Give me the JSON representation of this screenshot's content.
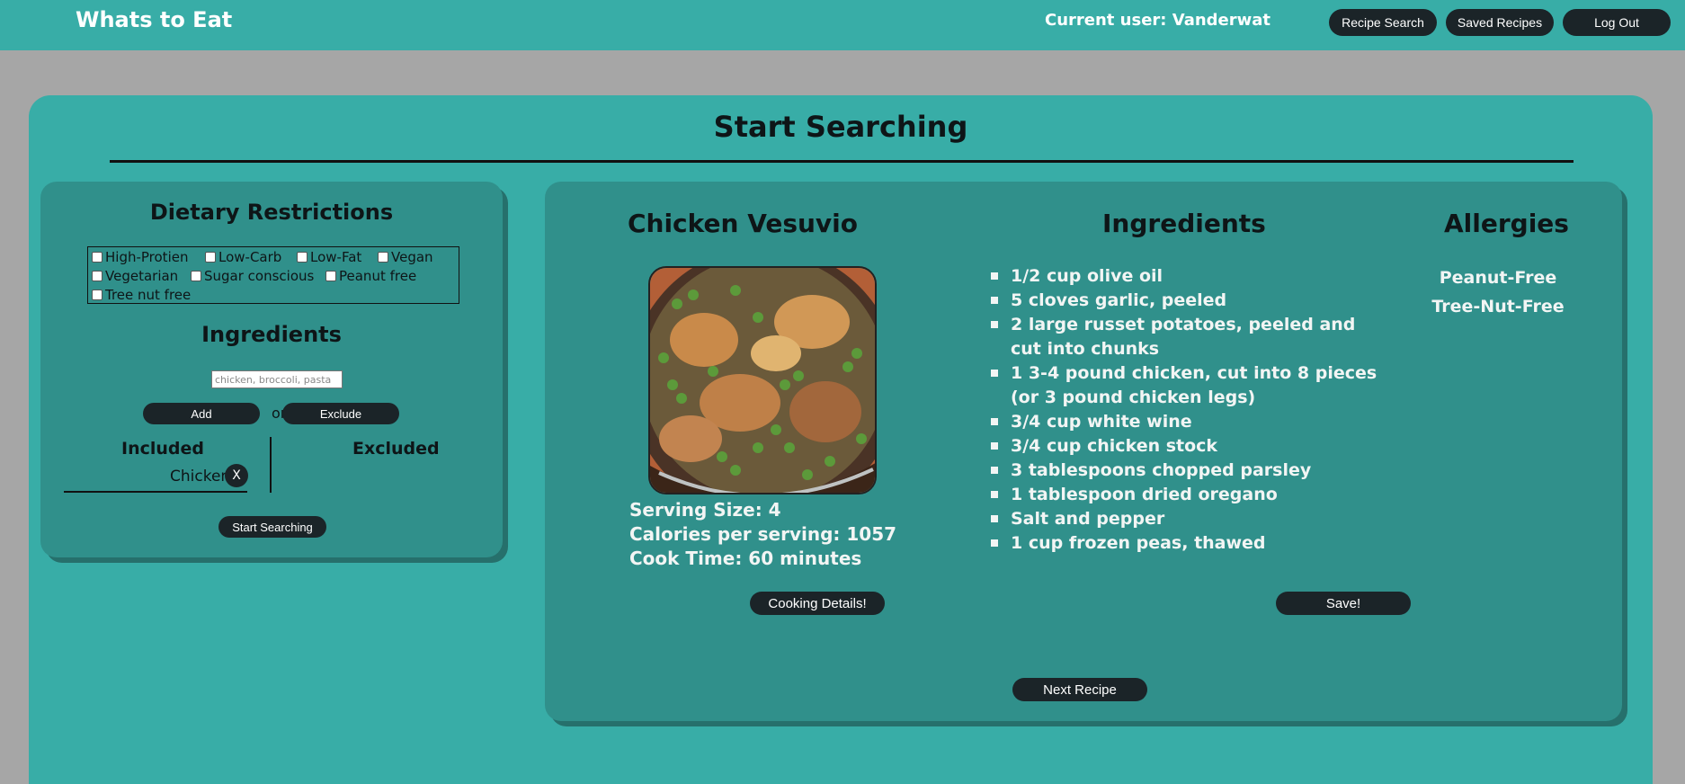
{
  "header": {
    "brand": "Whats to Eat",
    "current_user": "Current user: Vanderwat",
    "nav": [
      "Recipe Search",
      "Saved Recipes",
      "Log Out"
    ]
  },
  "page": {
    "title": "Start Searching"
  },
  "filters": {
    "dietary_title": "Dietary Restrictions",
    "restrictions": [
      "High-Protien",
      "Low-Carb",
      "Low-Fat",
      "Vegan",
      "Vegetarian",
      "Sugar conscious",
      "Peanut free",
      "Tree nut free"
    ],
    "ingredients_title": "Ingredients",
    "ingredient_placeholder": "chicken, broccoli, pasta",
    "add_label": "Add",
    "or_label": "or",
    "exclude_label": "Exclude",
    "included_title": "Included",
    "excluded_title": "Excluded",
    "included_items": [
      "Chicken"
    ],
    "remove_label": "X",
    "start_label": "Start Searching"
  },
  "recipe": {
    "name": "Chicken Vesuvio",
    "serving_size": "Serving Size: 4",
    "calories": "Calories per serving: 1057",
    "cook_time": "Cook Time: 60 minutes",
    "ingredients_title": "Ingredients",
    "ingredients": [
      "1/2 cup olive oil",
      "5 cloves garlic, peeled",
      "2 large russet potatoes, peeled and cut into chunks",
      "1 3-4 pound chicken, cut into 8 pieces (or 3 pound chicken legs)",
      "3/4 cup white wine",
      "3/4 cup chicken stock",
      "3 tablespoons chopped parsley",
      "1 tablespoon dried oregano",
      "Salt and pepper",
      "1 cup frozen peas, thawed"
    ],
    "allergies_title": "Allergies",
    "allergies": [
      "Peanut-Free",
      "Tree-Nut-Free"
    ],
    "details_label": "Cooking Details!",
    "save_label": "Save!",
    "next_label": "Next Recipe"
  }
}
